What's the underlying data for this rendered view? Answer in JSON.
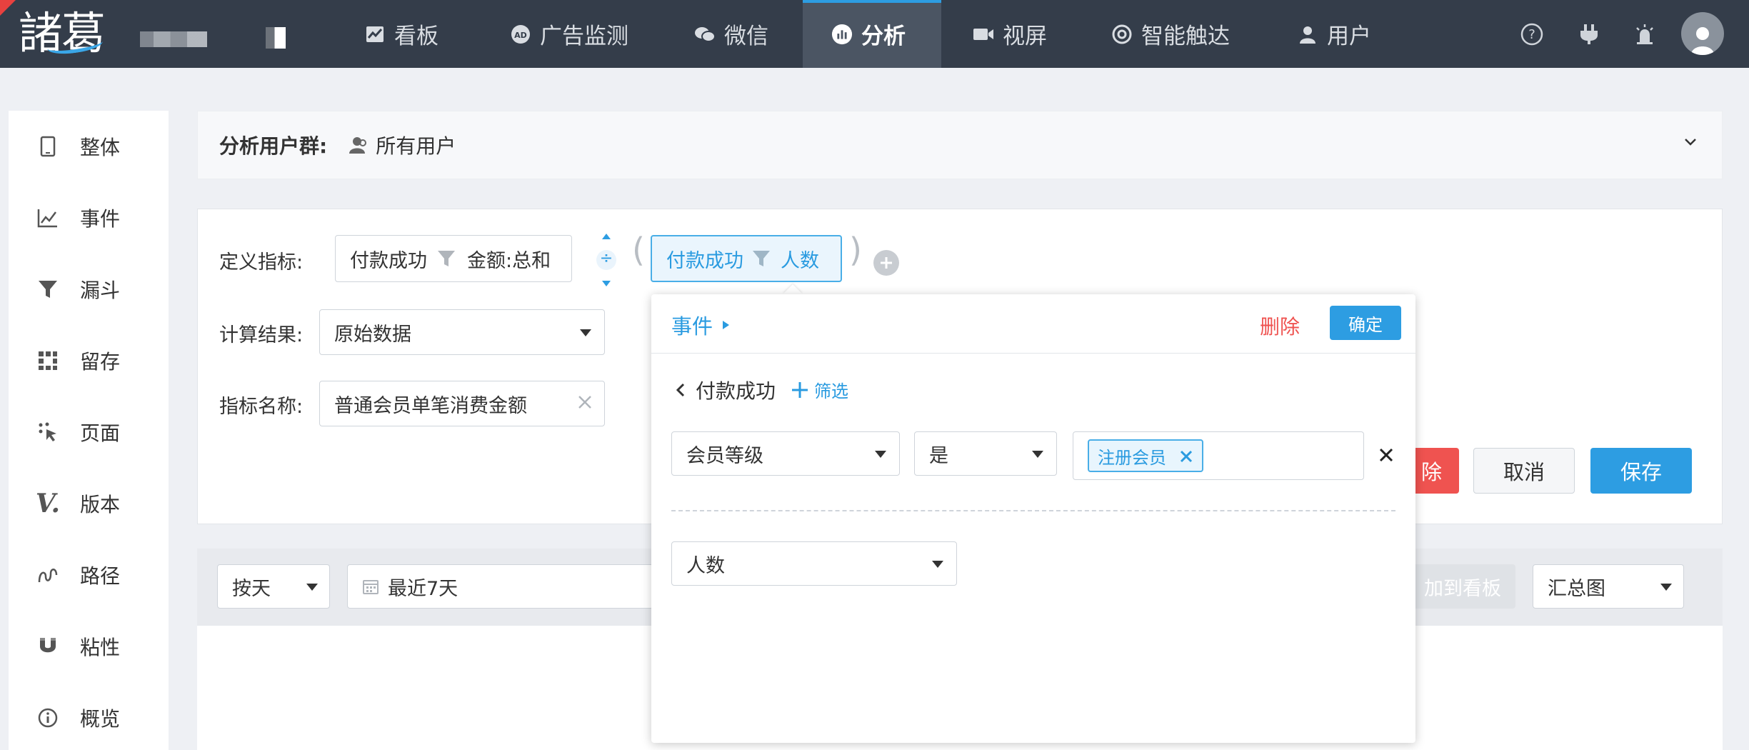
{
  "topnav": {
    "logo": "諸葛",
    "items": [
      {
        "label": "看板",
        "icon": "chart-line-icon"
      },
      {
        "label": "广告监测",
        "icon": "ad-icon"
      },
      {
        "label": "微信",
        "icon": "wechat-icon"
      },
      {
        "label": "分析",
        "icon": "analysis-icon",
        "active": true
      },
      {
        "label": "视屏",
        "icon": "video-icon"
      },
      {
        "label": "智能触达",
        "icon": "target-icon"
      },
      {
        "label": "用户",
        "icon": "user-icon"
      }
    ],
    "right_icons": [
      "help-icon",
      "plug-icon",
      "alarm-icon",
      "avatar-icon"
    ]
  },
  "sidebar": {
    "items": [
      {
        "label": "整体",
        "icon": "tablet-icon"
      },
      {
        "label": "事件",
        "icon": "line-chart-icon"
      },
      {
        "label": "漏斗",
        "icon": "funnel-icon"
      },
      {
        "label": "留存",
        "icon": "grid-icon"
      },
      {
        "label": "页面",
        "icon": "pointer-icon"
      },
      {
        "label": "版本",
        "icon": "version-icon"
      },
      {
        "label": "路径",
        "icon": "path-icon"
      },
      {
        "label": "粘性",
        "icon": "magnet-icon"
      },
      {
        "label": "概览",
        "icon": "info-icon"
      }
    ]
  },
  "group": {
    "label": "分析用户群:",
    "value": "所有用户",
    "icon": "users-icon"
  },
  "metric": {
    "define_label": "定义指标:",
    "left_event": "付款成功",
    "left_measure": "金额:总和",
    "operator": "÷",
    "open_paren": "(",
    "close_paren": ")",
    "right_event": "付款成功",
    "right_measure": "人数",
    "calc_label": "计算结果:",
    "calc_value": "原始数据",
    "name_label": "指标名称:",
    "name_value": "普通会员单笔消费金额"
  },
  "actions": {
    "delete_partial": "除",
    "cancel": "取消",
    "save": "保存"
  },
  "toolbar": {
    "interval": "按天",
    "date_range": "最近7天",
    "add_dashboard_partial": "加到看板",
    "chart_type": "汇总图"
  },
  "popover": {
    "title": "事件",
    "delete": "删除",
    "confirm": "确定",
    "event_name": "付款成功",
    "filter": "筛选",
    "filter_field": "会员等级",
    "filter_op": "是",
    "filter_tag": "注册会员",
    "measure": "人数"
  },
  "colors": {
    "topbar": "#343d4a",
    "accent": "#2d9de2",
    "danger": "#ef5350"
  }
}
